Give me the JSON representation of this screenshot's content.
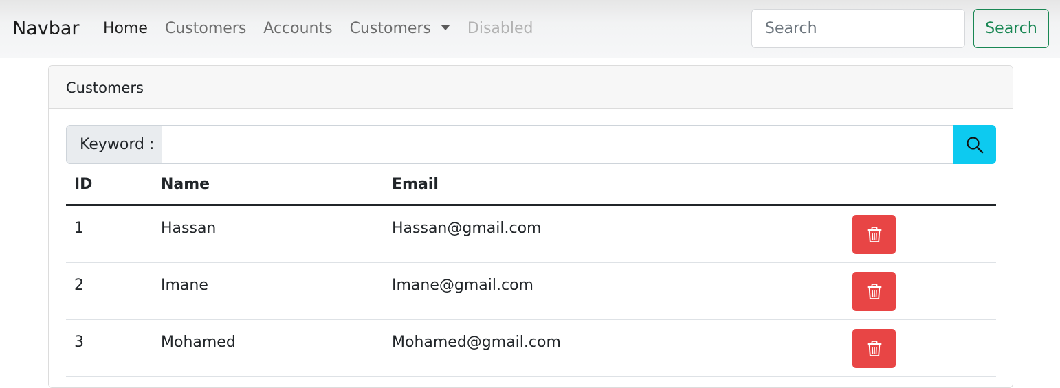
{
  "navbar": {
    "brand": "Navbar",
    "links": {
      "home": "Home",
      "customers": "Customers",
      "accounts": "Accounts",
      "customers_dropdown": "Customers",
      "disabled": "Disabled"
    },
    "search_placeholder": "Search",
    "search_button": "Search"
  },
  "card": {
    "title": "Customers",
    "keyword_label": "Keyword :",
    "keyword_value": ""
  },
  "table": {
    "headers": {
      "id": "ID",
      "name": "Name",
      "email": "Email"
    },
    "rows": [
      {
        "id": "1",
        "name": "Hassan",
        "email": "Hassan@gmail.com"
      },
      {
        "id": "2",
        "name": "Imane",
        "email": "Imane@gmail.com"
      },
      {
        "id": "3",
        "name": "Mohamed",
        "email": "Mohamed@gmail.com"
      }
    ]
  },
  "colors": {
    "success": "#198754",
    "info": "#0dcaf0",
    "danger": "#e84545"
  },
  "icons": {
    "keyword_search": "search-icon",
    "row_action": "trash-icon"
  }
}
